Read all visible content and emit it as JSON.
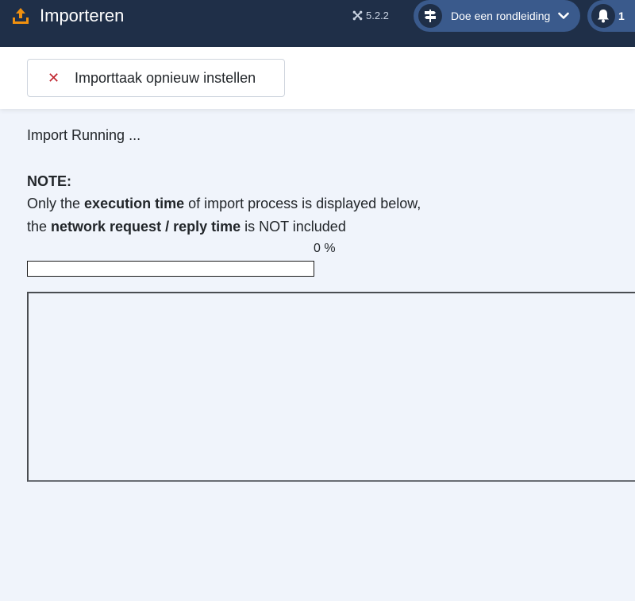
{
  "header": {
    "title": "Importeren",
    "version": "5.2.2",
    "tour_label": "Doe een rondleiding",
    "notification_count": "1"
  },
  "toolbar": {
    "reset_label": "Importtaak opnieuw instellen"
  },
  "main": {
    "status": "Import Running ...",
    "note_heading": "NOTE:",
    "line1": {
      "pre": "Only the ",
      "bold": "execution time",
      "post": " of import process is displayed below,"
    },
    "line2": {
      "pre": "the ",
      "bold": "network request / reply time",
      "post": " is NOT included"
    },
    "progress_text": "0 %",
    "progress_value": 0
  },
  "colors": {
    "header_bg": "#1f2f48",
    "accent_orange": "#f0900f",
    "button_bg": "#3a5a8c",
    "reset_icon": "#c0252f",
    "page_bg": "#f0f4fb"
  }
}
